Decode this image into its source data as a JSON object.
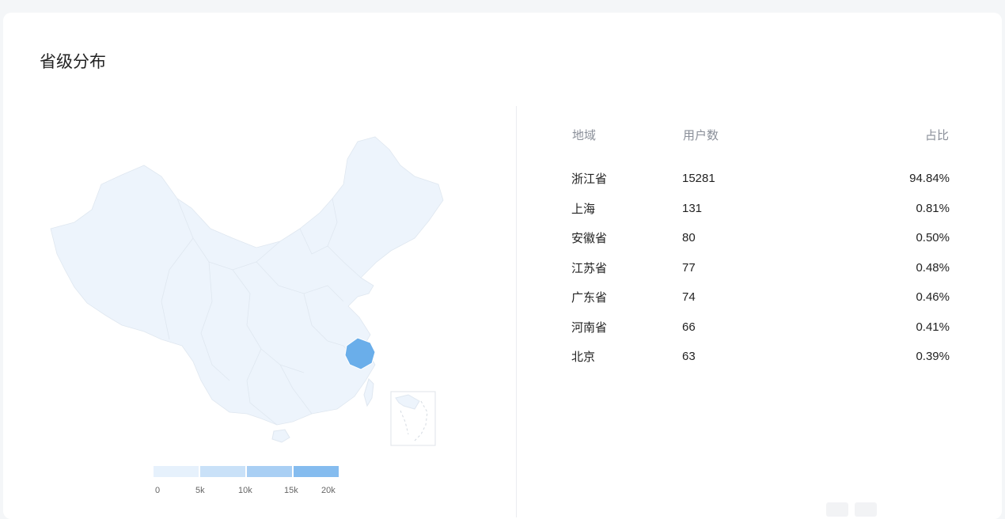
{
  "section": {
    "title": "省级分布"
  },
  "table": {
    "headers": {
      "region": "地域",
      "users": "用户数",
      "ratio": "占比"
    },
    "rows": [
      {
        "region": "浙江省",
        "users": "15281",
        "ratio": "94.84%"
      },
      {
        "region": "上海",
        "users": "131",
        "ratio": "0.81%"
      },
      {
        "region": "安徽省",
        "users": "80",
        "ratio": "0.50%"
      },
      {
        "region": "江苏省",
        "users": "77",
        "ratio": "0.48%"
      },
      {
        "region": "广东省",
        "users": "74",
        "ratio": "0.46%"
      },
      {
        "region": "河南省",
        "users": "66",
        "ratio": "0.41%"
      },
      {
        "region": "北京",
        "users": "63",
        "ratio": "0.39%"
      }
    ]
  },
  "legend": {
    "ticks": [
      "0",
      "5k",
      "10k",
      "15k",
      "20k"
    ],
    "colors": [
      "#e6f1fc",
      "#c9e1f8",
      "#a9cff4",
      "#85bcef"
    ]
  },
  "colors": {
    "map_base": "#edf4fc",
    "map_highlight": "#6aaeea",
    "map_border": "#dfe7f0"
  }
}
